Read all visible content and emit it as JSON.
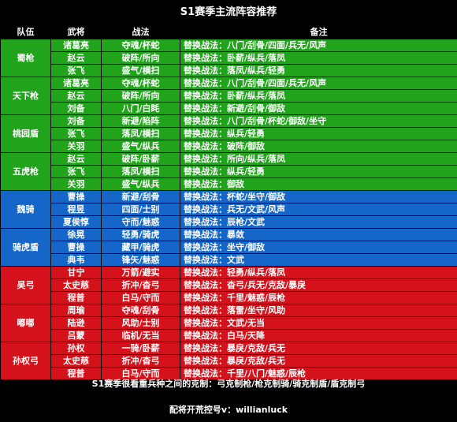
{
  "title": "S1赛季主流阵容推荐",
  "headers": {
    "team": "队伍",
    "general": "武将",
    "tactics": "战法",
    "notes": "备注"
  },
  "groups": [
    {
      "name": "蜀枪",
      "color": "green",
      "rows": [
        {
          "general": "诸葛亮",
          "tactics": "夺魂/杯蛇",
          "notes": "替换战法：八门/刮骨/四面/兵无/风声"
        },
        {
          "general": "赵云",
          "tactics": "破阵/所向",
          "notes": "替换战法：卧薪/纵兵/落凤"
        },
        {
          "general": "张飞",
          "tactics": "盛气/横扫",
          "notes": "替换战法：落凤/纵兵/轻勇"
        }
      ]
    },
    {
      "name": "天下枪",
      "color": "green",
      "rows": [
        {
          "general": "诸葛亮",
          "tactics": "夺魂/杯蛇",
          "notes": "替换战法：八门/刮骨/四面/兵无/风声"
        },
        {
          "general": "赵云",
          "tactics": "破阵/所向",
          "notes": "替换战法：卧薪/纵兵/落凤"
        },
        {
          "general": "刘备",
          "tactics": "八门/白眊",
          "notes": "替换战法：新避/刮骨/御敌"
        }
      ]
    },
    {
      "name": "桃园盾",
      "color": "green",
      "rows": [
        {
          "general": "刘备",
          "tactics": "新避/陷阵",
          "notes": "替换战法：八门/刮骨/杯蛇/御敌/坐守"
        },
        {
          "general": "张飞",
          "tactics": "落凤/横扫",
          "notes": "替换战法：纵兵/轻勇"
        },
        {
          "general": "关羽",
          "tactics": "盛气/纵兵",
          "notes": "替换战法：破阵/御敌"
        }
      ]
    },
    {
      "name": "五虎枪",
      "color": "green",
      "rows": [
        {
          "general": "赵云",
          "tactics": "破阵/卧薪",
          "notes": "替换战法：所向/纵兵/落凤"
        },
        {
          "general": "张飞",
          "tactics": "落凤/横扫",
          "notes": "替换战法：纵兵/轻勇"
        },
        {
          "general": "关羽",
          "tactics": "盛气/纵兵",
          "notes": "替换战法：御敌"
        }
      ]
    },
    {
      "name": "魏骑",
      "color": "blue",
      "rows": [
        {
          "general": "曹操",
          "tactics": "新避/刮骨",
          "notes": "替换战法：杯蛇/坐守/御敌"
        },
        {
          "general": "程昱",
          "tactics": "四面/士别",
          "notes": "替换战法：兵无/文武/风声"
        },
        {
          "general": "夏侯惇",
          "tactics": "守而/魅惑",
          "notes": "替换战法：辰枪/文武"
        }
      ]
    },
    {
      "name": "骑虎盾",
      "color": "blue",
      "rows": [
        {
          "general": "徐晃",
          "tactics": "轻勇/骑虎",
          "notes": "替换战法：暴敛"
        },
        {
          "general": "曹操",
          "tactics": "藏甲/骑虎",
          "notes": "替换战法：坐守/御敌"
        },
        {
          "general": "典韦",
          "tactics": "锋矢/魅惑",
          "notes": "替换战法：文武"
        }
      ]
    },
    {
      "name": "吴弓",
      "color": "red",
      "rows": [
        {
          "general": "甘宁",
          "tactics": "万箭/避实",
          "notes": "替换战法：轻勇/纵兵/落凤"
        },
        {
          "general": "太史慈",
          "tactics": "折冲/杳弓",
          "notes": "替换战法：杳弓/兵无/克敌/暴戾"
        },
        {
          "general": "程普",
          "tactics": "白马/守而",
          "notes": "替换战法：千里/魅惑/辰枪"
        }
      ]
    },
    {
      "name": "嘟嘟",
      "color": "red",
      "rows": [
        {
          "general": "周瑜",
          "tactics": "夺魂/刮骨",
          "notes": "替换战法：落雷/坐守/风助"
        },
        {
          "general": "陆逊",
          "tactics": "风助/士别",
          "notes": "替换战法：文武/无当"
        },
        {
          "general": "吕蒙",
          "tactics": "临机/无当",
          "notes": "替换战法：白马/天降"
        }
      ]
    },
    {
      "name": "孙权弓",
      "color": "red",
      "rows": [
        {
          "general": "孙权",
          "tactics": "一骑/卧薪",
          "notes": "替换战法：暴戾/克敌/兵无"
        },
        {
          "general": "太史慈",
          "tactics": "折冲/杳弓",
          "notes": "替换战法：暴戾/克敌/兵无"
        },
        {
          "general": "程普",
          "tactics": "白马/守而",
          "notes": "替换战法：千里/八门/魅惑/辰枪"
        }
      ]
    }
  ],
  "footer": {
    "line1": "S1赛季很看重兵种之间的克制：弓克制枪/枪克制骑/骑克制盾/盾克制弓",
    "line2": "配将开荒控号v：willianluck"
  },
  "colors": {
    "green": "#22a31c",
    "blue": "#1466c8",
    "red": "#d5121c",
    "background": "#000000"
  }
}
